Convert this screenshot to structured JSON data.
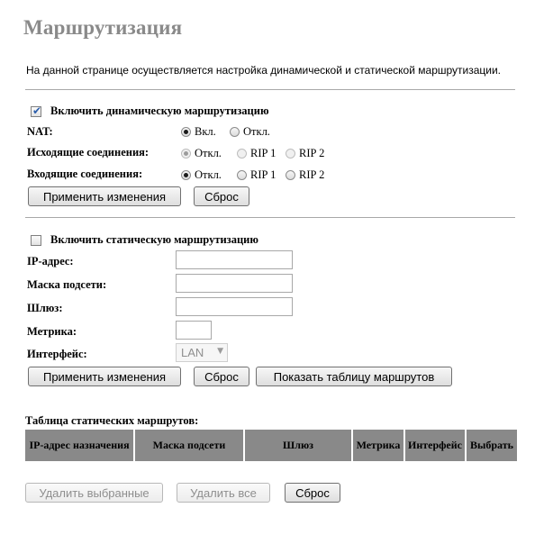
{
  "page": {
    "title": "Маршрутизация",
    "description": "На данной странице осуществляется настройка динамической и статической маршрутизации."
  },
  "dynamic": {
    "enable_label": "Включить динамическую маршрутизацию",
    "enabled": true,
    "nat": {
      "label": "NAT:",
      "options": [
        "Вкл.",
        "Откл."
      ],
      "selected": "Вкл."
    },
    "outgoing": {
      "label": "Исходящие соединения:",
      "options": [
        "Откл.",
        "RIP 1",
        "RIP 2"
      ],
      "selected": "Откл."
    },
    "incoming": {
      "label": "Входящие соединения:",
      "options": [
        "Откл.",
        "RIP 1",
        "RIP 2"
      ],
      "selected": "Откл."
    },
    "apply_label": "Применить изменения",
    "reset_label": "Сброс"
  },
  "static": {
    "enable_label": "Включить статическую маршрутизацию",
    "enabled": false,
    "ip_label": "IP-адрес:",
    "ip_value": "",
    "mask_label": "Маска подсети:",
    "mask_value": "",
    "gateway_label": "Шлюз:",
    "gateway_value": "",
    "metric_label": "Метрика:",
    "metric_value": "",
    "interface_label": "Интерфейс:",
    "interface_value": "LAN",
    "apply_label": "Применить изменения",
    "reset_label": "Сброс",
    "show_table_label": "Показать таблицу маршрутов"
  },
  "route_table": {
    "title": "Таблица статических маршрутов:",
    "columns": [
      "IP-адрес назначения",
      "Маска подсети",
      "Шлюз",
      "Метрика",
      "Интерфейс",
      "Выбрать"
    ],
    "header_color": "#898989",
    "rows": [],
    "delete_selected_label": "Удалить выбранные",
    "delete_all_label": "Удалить все",
    "reset_label": "Сброс"
  }
}
